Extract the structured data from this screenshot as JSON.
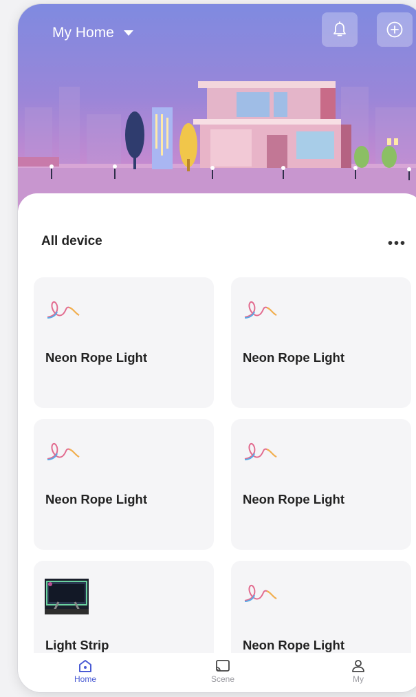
{
  "header": {
    "home_name": "My Home"
  },
  "icons": {
    "bell": "bell-icon",
    "add": "add-circle-icon",
    "more": "more-dots-icon"
  },
  "section": {
    "title": "All device",
    "more_label": "•••"
  },
  "devices": [
    {
      "name": "Neon Rope Light",
      "icon": "neon-rope-icon"
    },
    {
      "name": "Neon Rope Light",
      "icon": "neon-rope-icon"
    },
    {
      "name": "Neon Rope Light",
      "icon": "neon-rope-icon"
    },
    {
      "name": "Neon Rope Light",
      "icon": "neon-rope-icon"
    },
    {
      "name": "Light Strip",
      "icon": "light-strip-thumbnail"
    },
    {
      "name": "Neon Rope Light",
      "icon": "neon-rope-icon"
    }
  ],
  "tabs": [
    {
      "label": "Home",
      "icon": "home-icon",
      "active": true
    },
    {
      "label": "Scene",
      "icon": "scene-cast-icon",
      "active": false
    },
    {
      "label": "My",
      "icon": "person-icon",
      "active": false
    }
  ],
  "colors": {
    "accent": "#4a5bd4",
    "inactive_tab": "#9a9aa0",
    "hero_top": "#7f8ae0",
    "hero_bottom": "#d98fc4"
  }
}
